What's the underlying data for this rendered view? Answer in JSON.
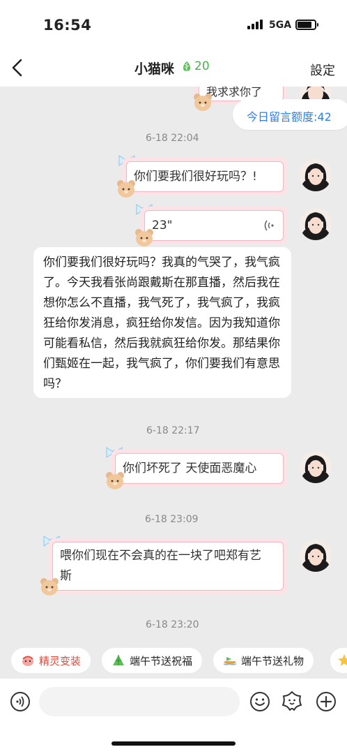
{
  "status_bar": {
    "time": "16:54",
    "network": "5GA",
    "battery_level": 0.85
  },
  "nav": {
    "title": "小猫咪",
    "badge_count": "20",
    "settings_label": "設定"
  },
  "quota": {
    "label": "今日留言额度:42"
  },
  "partial_message": "我求求你了",
  "messages": [
    {
      "timestamp": "6-18 22:04"
    },
    {
      "text": "你们要我们很好玩吗？!"
    },
    {
      "duration": "23\""
    },
    {
      "text": "你们要我们很好玩吗？我真的气哭了，我气疯了。今天我看张尚跟戴斯在那直播，然后我在想你怎么不直播，我气死了，我气疯了，我疯狂给你发消息，疯狂给你发信。因为我知道你可能看私信，然后我就疯狂给你发。那结果你们甄姬在一起，我气疯了，你们要我们有意思吗？"
    },
    {
      "timestamp": "6-18 22:17"
    },
    {
      "text": "你们坏死了 天使面恶魔心"
    },
    {
      "timestamp": "6-18 23:09"
    },
    {
      "text": "喂你们现在不会真的在一块了吧郑有艺斯"
    },
    {
      "timestamp": "6-18 23:20"
    }
  ],
  "quick_replies": [
    {
      "label": "精灵变装",
      "icon": "sprite-icon"
    },
    {
      "label": "端午节送祝福",
      "icon": "zongzi-icon"
    },
    {
      "label": "端午节送礼物",
      "icon": "dragon-boat-icon"
    }
  ],
  "input": {
    "placeholder": ""
  },
  "colors": {
    "accent_blue": "#2a7ef2",
    "badge_green": "#4caf50",
    "chip_red": "#e14a3c",
    "bubble_pink": "#f2b6c2"
  }
}
